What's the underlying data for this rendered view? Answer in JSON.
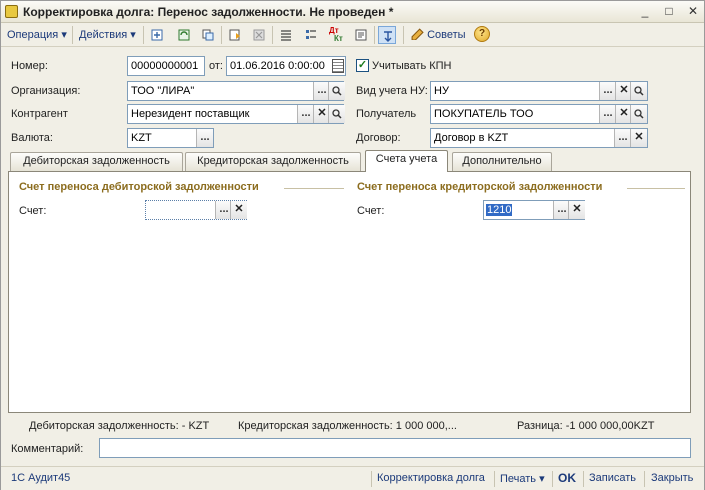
{
  "window": {
    "title": "Корректировка долга: Перенос задолженности. Не проведен *",
    "minimize": "_",
    "maximize": "□",
    "close": "✕"
  },
  "toolbar": {
    "operation_menu": "Операция ▾",
    "actions_menu": "Действия ▾",
    "icons": [
      "post-icon",
      "refresh-icon",
      "copy-icon",
      "fill-icon",
      "delete-icon",
      "list-icon",
      "structure-icon",
      "dt-kt-icon",
      "report-icon",
      "move-icon"
    ],
    "dtkt_top": "Дт",
    "dtkt_bottom": "Кт",
    "tips_label": "Советы",
    "help_label": "?"
  },
  "form": {
    "number_label": "Номер:",
    "number_value": "00000000001",
    "date_label": "от:",
    "date_value": "01.06.2016  0:00:00",
    "kpn_label": "Учитывать КПН",
    "kpn_checked": "✓",
    "org_label": "Организация:",
    "org_value": "ТОО \"ЛИРА\"",
    "nu_label": "Вид учета НУ:",
    "nu_value": "НУ",
    "counterparty_label": "Контрагент",
    "counterparty_value": "Нерезидент поставщик",
    "recipient_label": "Получатель",
    "recipient_value": "ПОКУПАТЕЛЬ ТОО",
    "currency_label": "Валюта:",
    "currency_value": "KZT",
    "contract_label": "Договор:",
    "contract_value": "Договор в KZT",
    "select_btn": "...",
    "clear_btn": "✕",
    "search_btn": "🔍"
  },
  "tabs": [
    {
      "label": "Дебиторская задолженность"
    },
    {
      "label": "Кредиторская задолженность"
    },
    {
      "label": "Счета учета"
    },
    {
      "label": "Дополнительно"
    }
  ],
  "accounts": {
    "debit_group_title": "Счет переноса дебиторской задолженности",
    "debit_account_label": "Счет:",
    "debit_account_value": "",
    "credit_group_title": "Счет переноса кредиторской задолженности",
    "credit_account_label": "Счет:",
    "credit_account_value": "1210"
  },
  "totals": {
    "debit": "Дебиторская задолженность: - KZT",
    "credit": "Кредиторская задолженность: 1 000 000,...",
    "difference": "Разница: -1 000 000,00KZT"
  },
  "comment_label": "Комментарий:",
  "comment_value": "",
  "statusbar": {
    "app_name": "1С Аудит45",
    "doc_link": "Корректировка долга",
    "print_menu": "Печать ▾",
    "ok": "OK",
    "save": "Записать",
    "close": "Закрыть"
  }
}
